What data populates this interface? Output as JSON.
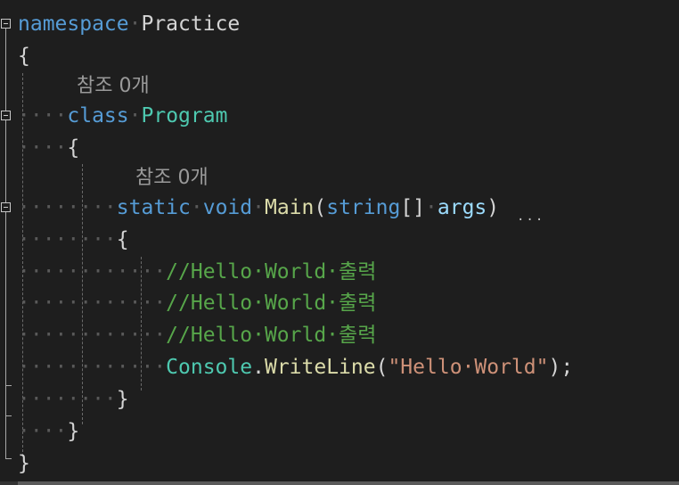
{
  "code": {
    "namespace_kw": "namespace",
    "namespace_name": "Practice",
    "open_brace": "{",
    "close_brace": "}",
    "lens_1": "참조 0개",
    "class_kw": "class",
    "class_name": "Program",
    "lens_2": "참조 0개",
    "static_kw": "static",
    "void_kw": "void",
    "method_name": "Main",
    "paren_open": "(",
    "param_type": "string",
    "array_brackets": "[]",
    "param_name": "args",
    "paren_close": ")",
    "comment_1": "//Hello·World·출력",
    "comment_2": "//Hello·World·출력",
    "comment_3": "//Hello·World·출력",
    "console_type": "Console",
    "dot": ".",
    "writeline": "WriteLine",
    "string_literal": "\"Hello·World\"",
    "end_stmt": ");"
  },
  "whitespace": {
    "indent_1": "····",
    "indent_2": "········",
    "indent_3": "············",
    "sep": "·"
  },
  "hint_dots": "···",
  "colors": {
    "background": "#1e1e1e",
    "keyword": "#569cd6",
    "type": "#4ec9b0",
    "method": "#dcdcaa",
    "string": "#ce9178",
    "comment": "#57a64a",
    "parameter": "#9cdcfe"
  }
}
